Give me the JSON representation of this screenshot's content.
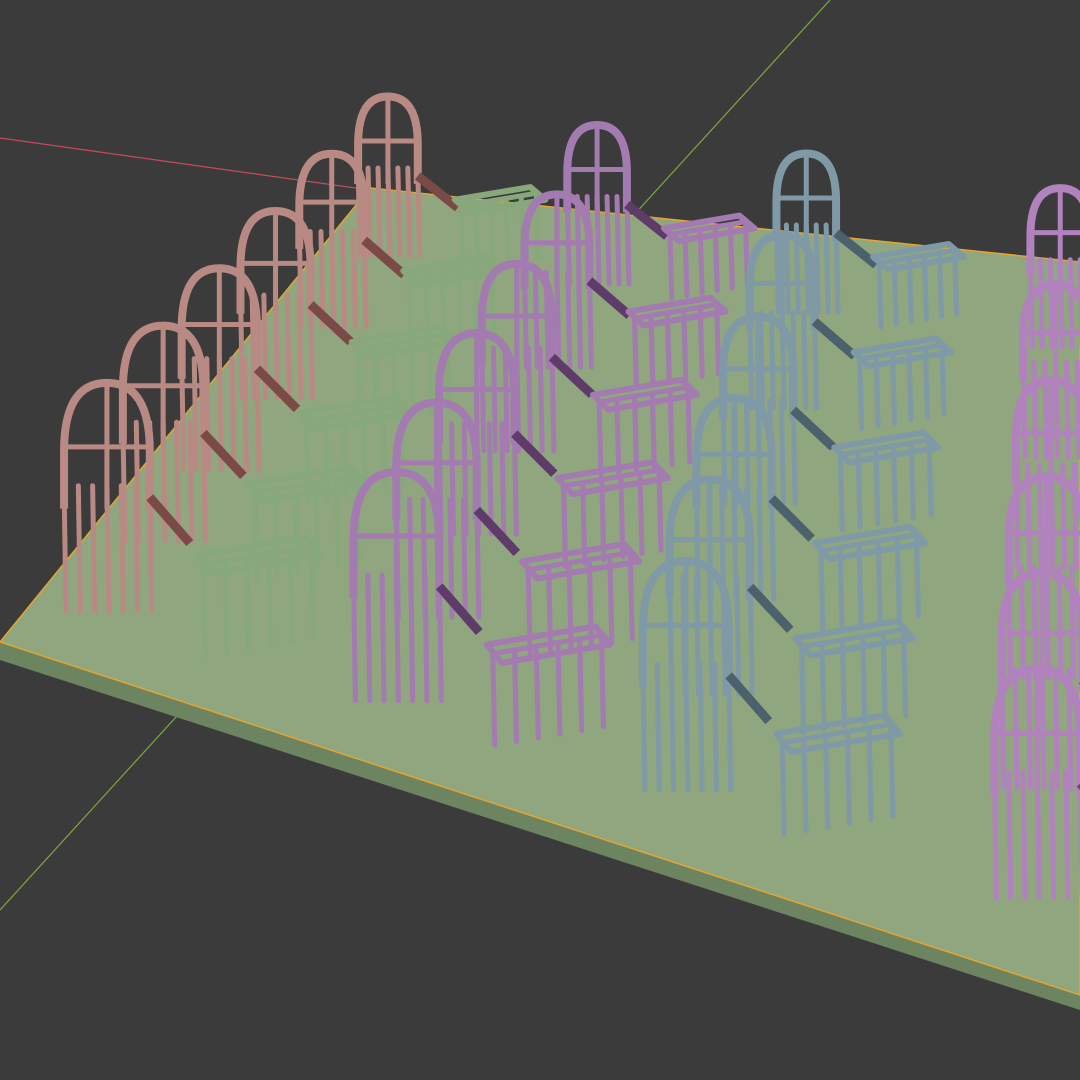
{
  "viewport": {
    "background": "#3b3b3b",
    "grid_on": false,
    "axes": {
      "x_color": "#c94a5a",
      "y_color": "#7fa83a"
    },
    "selection_outline_color": "#e6a431"
  },
  "build_plate": {
    "top_color": "#8fa67f",
    "edge_color": "#6d8460"
  },
  "object_groups": [
    {
      "kind": "arch-frames",
      "color": "#b98a83",
      "shadow": "#7b4a47",
      "count": 6
    },
    {
      "kind": "rack-frames",
      "color": "#86a87b",
      "shadow": "#4f6d47",
      "count": 6
    },
    {
      "kind": "arch-frames",
      "color": "#a47bb1",
      "shadow": "#5e3b69",
      "count": 6
    },
    {
      "kind": "rack-frames",
      "color": "#a47bb1",
      "shadow": "#5e3b69",
      "count": 6
    },
    {
      "kind": "arch-frames",
      "color": "#7f9aa6",
      "shadow": "#4b626c",
      "count": 6
    },
    {
      "kind": "rack-frames",
      "color": "#7f9aa6",
      "shadow": "#4b626c",
      "count": 6
    },
    {
      "kind": "arch-frames",
      "color": "#b182bd",
      "shadow": "#6c4679",
      "count": 6
    }
  ]
}
